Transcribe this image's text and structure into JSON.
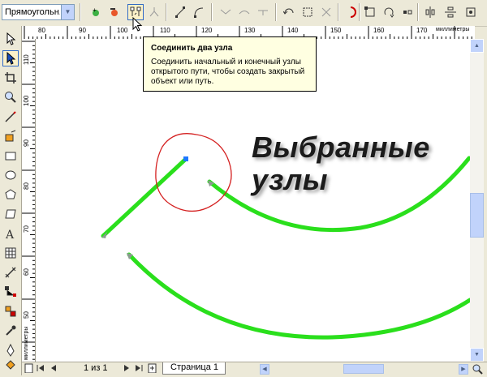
{
  "property_bar": {
    "shape_select_value": "Прямоугольн..."
  },
  "ruler": {
    "top_labels": [
      "80",
      "90",
      "100",
      "110",
      "120",
      "130",
      "140",
      "150",
      "160",
      "170"
    ],
    "left_labels": [
      "110",
      "100",
      "90",
      "80",
      "70",
      "60",
      "50"
    ],
    "units": "миллиметры"
  },
  "tooltip": {
    "title": "Соединить два узла",
    "body": "Соединить начальный и конечный узлы открытого пути, чтобы создать закрытый объект или путь."
  },
  "canvas": {
    "caption_line1": "Выбранные",
    "caption_line2": "узлы",
    "curve_color": "#2adf1c",
    "highlight_color": "#d42020"
  },
  "status": {
    "page_counter": "1 из 1",
    "page_tab": "Страница 1"
  },
  "colors": {
    "chrome": "#ece9d8",
    "tooltip_bg": "#ffffe1",
    "active_border": "#316ac5"
  }
}
